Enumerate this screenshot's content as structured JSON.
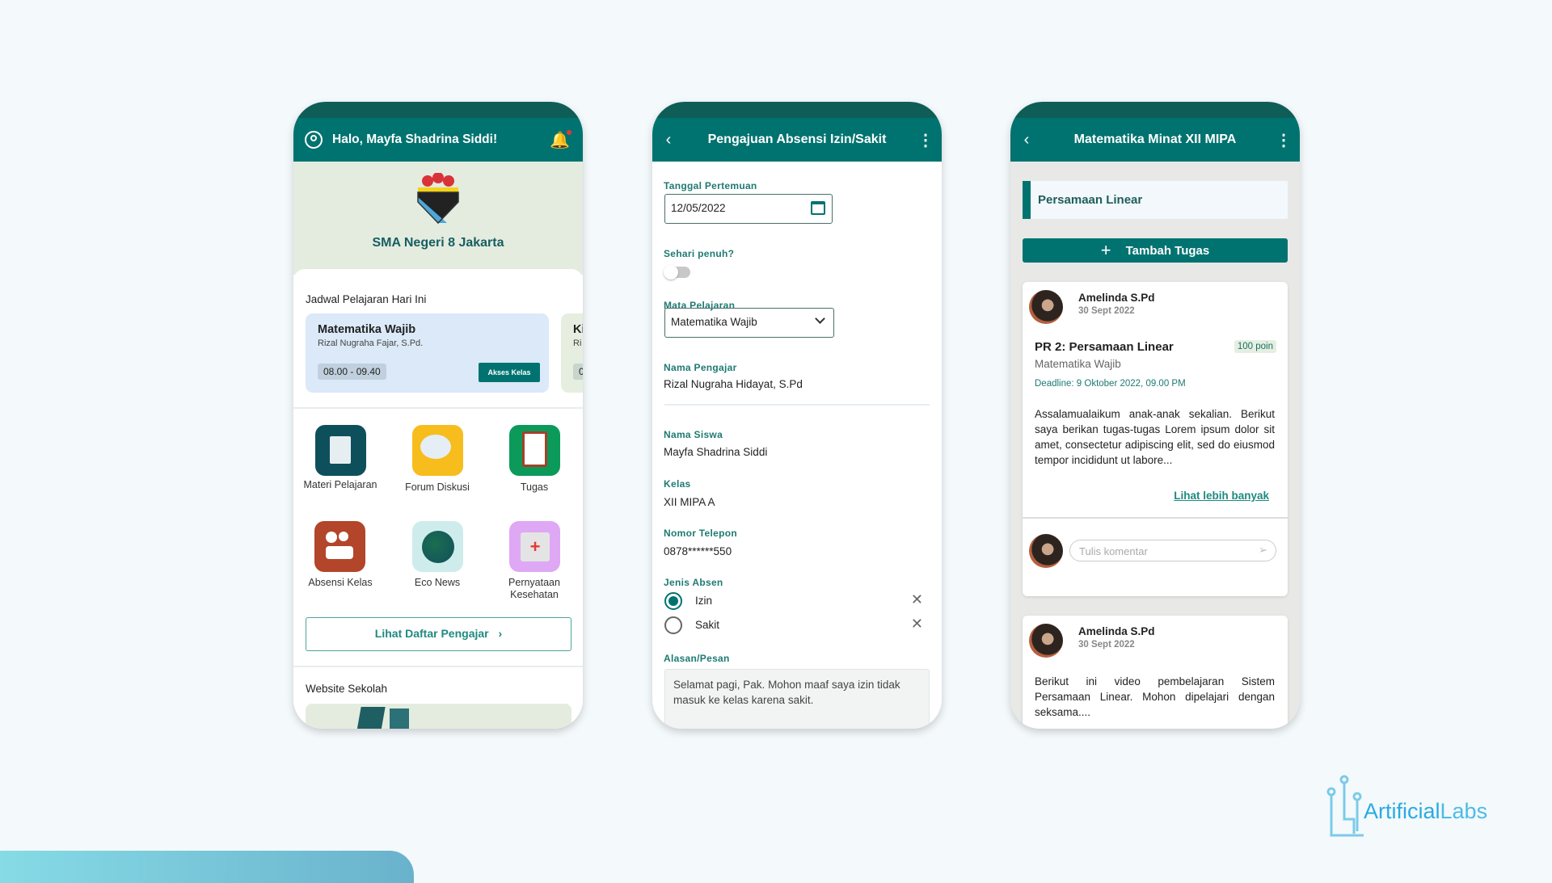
{
  "colors": {
    "primary": "#007370",
    "primary_dark": "#0e5e57",
    "background": "#f4f9fc",
    "brand": "#29abe2"
  },
  "home": {
    "greeting": "Halo, Mayfa Shadrina Siddi!",
    "icons": {
      "profile": "user-circle-icon",
      "notification": "bell-icon"
    },
    "school_name": "SMA Negeri 8 Jakarta",
    "schedule_title": "Jadwal Pelajaran Hari Ini",
    "schedule": [
      {
        "subject": "Matematika Wajib",
        "teacher": "Rizal Nugraha Fajar, S.Pd.",
        "time": "08.00 - 09.40",
        "action": "Akses Kelas"
      },
      {
        "subject": "Ki",
        "teacher": "Ri",
        "time": "0"
      }
    ],
    "menu": [
      {
        "label": "Materi Pelajaran",
        "icon": "books-icon",
        "color": "#0e4f5c"
      },
      {
        "label": "Forum Diskusi",
        "icon": "chat-bubbles-icon",
        "color": "#f6bd1d"
      },
      {
        "label": "Tugas",
        "icon": "clipboard-icon",
        "color": "#0b9a5a"
      },
      {
        "label": "Absensi Kelas",
        "icon": "attendance-icon",
        "color": "#b2452a"
      },
      {
        "label": "Eco News",
        "icon": "globe-icon",
        "color": "#cfecec"
      },
      {
        "label": "Pernyataan Kesehatan",
        "icon": "health-kit-icon",
        "color": "#dfa8f5"
      }
    ],
    "teacher_list_button": "Lihat Daftar Pengajar",
    "website_title": "Website Sekolah"
  },
  "absence": {
    "title": "Pengajuan Absensi Izin/Sakit",
    "date_label": "Tanggal Pertemuan",
    "date_value": "12/05/2022",
    "fullday_label": "Sehari penuh?",
    "fullday_on": false,
    "subject_label": "Mata Pelajaran",
    "subject_value": "Matematika Wajib",
    "teacher_label": "Nama Pengajar",
    "teacher_value": "Rizal Nugraha Hidayat, S.Pd",
    "student_label": "Nama Siswa",
    "student_value": "Mayfa Shadrina Siddi",
    "class_label": "Kelas",
    "class_value": "XII MIPA A",
    "phone_label": "Nomor Telepon",
    "phone_value": "0878******550",
    "type_label": "Jenis Absen",
    "types": [
      {
        "label": "Izin",
        "selected": true
      },
      {
        "label": "Sakit",
        "selected": false
      }
    ],
    "reason_label": "Alasan/Pesan",
    "reason_value": "Selamat pagi, Pak. Mohon maaf saya izin tidak masuk ke kelas karena sakit."
  },
  "classroom": {
    "title": "Matematika Minat XII MIPA",
    "section": "Persamaan Linear",
    "add_button": "Tambah Tugas",
    "posts": [
      {
        "author": "Amelinda S.Pd",
        "date": "30 Sept 2022",
        "task_title": "PR 2: Persamaan Linear",
        "points": "100 poin",
        "subject": "Matematika Wajib",
        "deadline": "Deadline: 9 Oktober 2022, 09.00 PM",
        "body": "Assalamualaikum anak-anak sekalian. Berikut saya berikan tugas-tugas Lorem ipsum dolor sit amet, consectetur adipiscing elit, sed do eiusmod tempor incididunt ut labore...",
        "more": "Lihat lebih banyak",
        "comment_placeholder": "Tulis komentar"
      },
      {
        "author": "Amelinda S.Pd",
        "date": "30 Sept 2022",
        "body": "Berikut ini video pembelajaran Sistem Persamaan Linear. Mohon dipelajari dengan seksama...."
      }
    ]
  },
  "brand": {
    "name_a": "Artificial",
    "name_b": "Labs"
  }
}
